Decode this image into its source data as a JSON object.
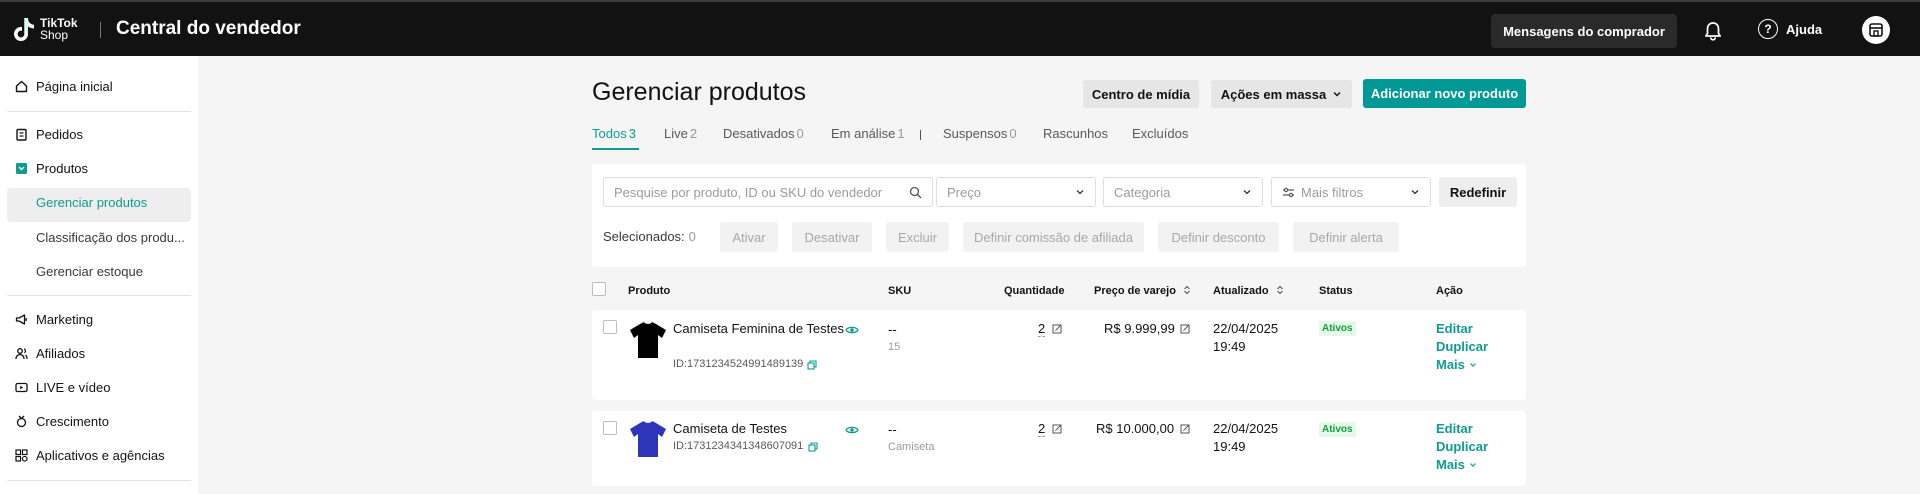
{
  "header": {
    "logo_text_1": "TikTok",
    "logo_text_2": "Shop",
    "title": "Central do vendedor",
    "messages_button": "Mensagens do comprador",
    "help_label": "Ajuda"
  },
  "sidebar": {
    "items": [
      {
        "label": "Página inicial",
        "icon": "home-icon"
      },
      {
        "label": "Pedidos",
        "icon": "clipboard-icon"
      },
      {
        "label": "Produtos",
        "icon": "box-icon"
      },
      {
        "label": "Marketing",
        "icon": "megaphone-icon"
      },
      {
        "label": "Afiliados",
        "icon": "people-icon"
      },
      {
        "label": "LIVE e vídeo",
        "icon": "live-icon"
      },
      {
        "label": "Crescimento",
        "icon": "medal-icon"
      },
      {
        "label": "Aplicativos e agências",
        "icon": "apps-icon"
      }
    ],
    "sub_items": [
      {
        "label": "Gerenciar produtos",
        "active": true
      },
      {
        "label": "Classificação dos produ..."
      },
      {
        "label": "Gerenciar estoque"
      }
    ]
  },
  "main": {
    "title": "Gerenciar produtos",
    "media_center_button": "Centro de mídia",
    "bulk_actions_button": "Ações em massa",
    "add_product_button": "Adicionar novo produto",
    "tabs": [
      {
        "label": "Todos",
        "count": "3",
        "active": true
      },
      {
        "label": "Live",
        "count": "2"
      },
      {
        "label": "Desativados",
        "count": "0"
      },
      {
        "label": "Em análise",
        "count": "1"
      },
      {
        "label": "Suspensos",
        "count": "0"
      },
      {
        "label": "Rascunhos",
        "count": ""
      },
      {
        "label": "Excluídos",
        "count": ""
      }
    ],
    "filters": {
      "search_placeholder": "Pesquise por produto, ID ou SKU do vendedor",
      "price_placeholder": "Preço",
      "category_placeholder": "Categoria",
      "more_filters": "Mais filtros",
      "reset_button": "Redefinir"
    },
    "selection": {
      "label": "Selecionados:",
      "count": "0",
      "actions": [
        "Ativar",
        "Desativar",
        "Excluir",
        "Definir comissão de afiliada",
        "Definir desconto",
        "Definir alerta"
      ]
    },
    "table": {
      "headers": [
        "Produto",
        "SKU",
        "Quantidade",
        "Preço de varejo",
        "Atualizado",
        "Status",
        "Ação"
      ],
      "rows": [
        {
          "name": "Camiseta Feminina de Testes",
          "id": "ID:1731234524991489139",
          "sku": "--",
          "sku_sub": "15",
          "quantity": "2",
          "price": "R$ 9.999,99",
          "date": "22/04/2025",
          "time": "19:49",
          "status": "Ativos",
          "actions": [
            "Editar",
            "Duplicar",
            "Mais"
          ],
          "thumb_color": "#000000"
        },
        {
          "name": "Camiseta de Testes",
          "id": "ID:1731234341348607091",
          "sku": "--",
          "sku_sub": "Camiseta",
          "quantity": "2",
          "price": "R$ 10.000,00",
          "date": "22/04/2025",
          "time": "19:49",
          "status": "Ativos",
          "actions": [
            "Editar",
            "Duplicar",
            "Mais"
          ],
          "thumb_color": "#2e35b8"
        }
      ]
    }
  },
  "colors": {
    "accent": "#0e9c91",
    "primary_button": "#009995",
    "topbar": "#121212",
    "status_green": "#11a33a"
  }
}
